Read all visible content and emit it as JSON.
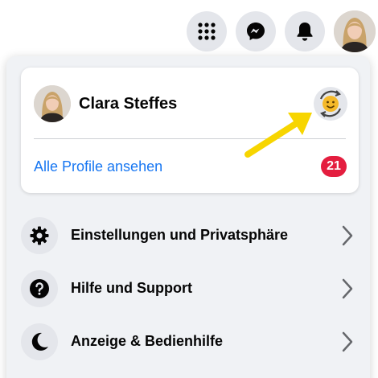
{
  "header": {
    "icons": [
      "menu-grid-icon",
      "messenger-icon",
      "bell-icon",
      "profile-avatar"
    ]
  },
  "profile": {
    "name": "Clara Steffes",
    "switch_icon": "profile-switch-smiley-icon",
    "see_all_label": "Alle Profile ansehen",
    "badge_count": "21"
  },
  "menu": {
    "items": [
      {
        "label": "Einstellungen und Privatsphäre",
        "icon": "gear-icon"
      },
      {
        "label": "Hilfe und Support",
        "icon": "question-icon"
      },
      {
        "label": "Anzeige & Bedienhilfe",
        "icon": "moon-icon"
      }
    ]
  },
  "colors": {
    "accent": "#1877f2",
    "badge": "#e41e3f",
    "icon_bg": "#e4e6eb",
    "panel_bg": "#f0f2f5",
    "annotation": "#f7d500"
  }
}
